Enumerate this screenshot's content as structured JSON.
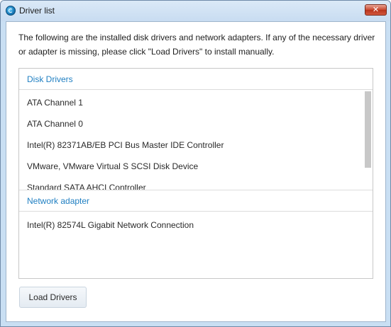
{
  "window": {
    "title": "Driver list",
    "close_glyph": "✕"
  },
  "intro_text": "The following are the installed disk drivers and network adapters. If any of the necessary driver or adapter is missing, please click \"Load Drivers\" to install manually.",
  "disk_drivers": {
    "header": "Disk Drivers",
    "items": [
      "ATA Channel 1",
      "ATA Channel 0",
      "Intel(R) 82371AB/EB PCI Bus Master IDE Controller",
      "VMware, VMware Virtual S SCSI Disk Device",
      "Standard SATA AHCI Controller"
    ]
  },
  "network_adapter": {
    "header": "Network adapter",
    "items": [
      "Intel(R) 82574L Gigabit Network Connection"
    ]
  },
  "buttons": {
    "load_drivers": "Load Drivers"
  },
  "icons": {
    "app": "app-logo-icon",
    "close": "close-icon"
  },
  "colors": {
    "section_header": "#1f7fc2",
    "close_button": "#c9472f"
  }
}
